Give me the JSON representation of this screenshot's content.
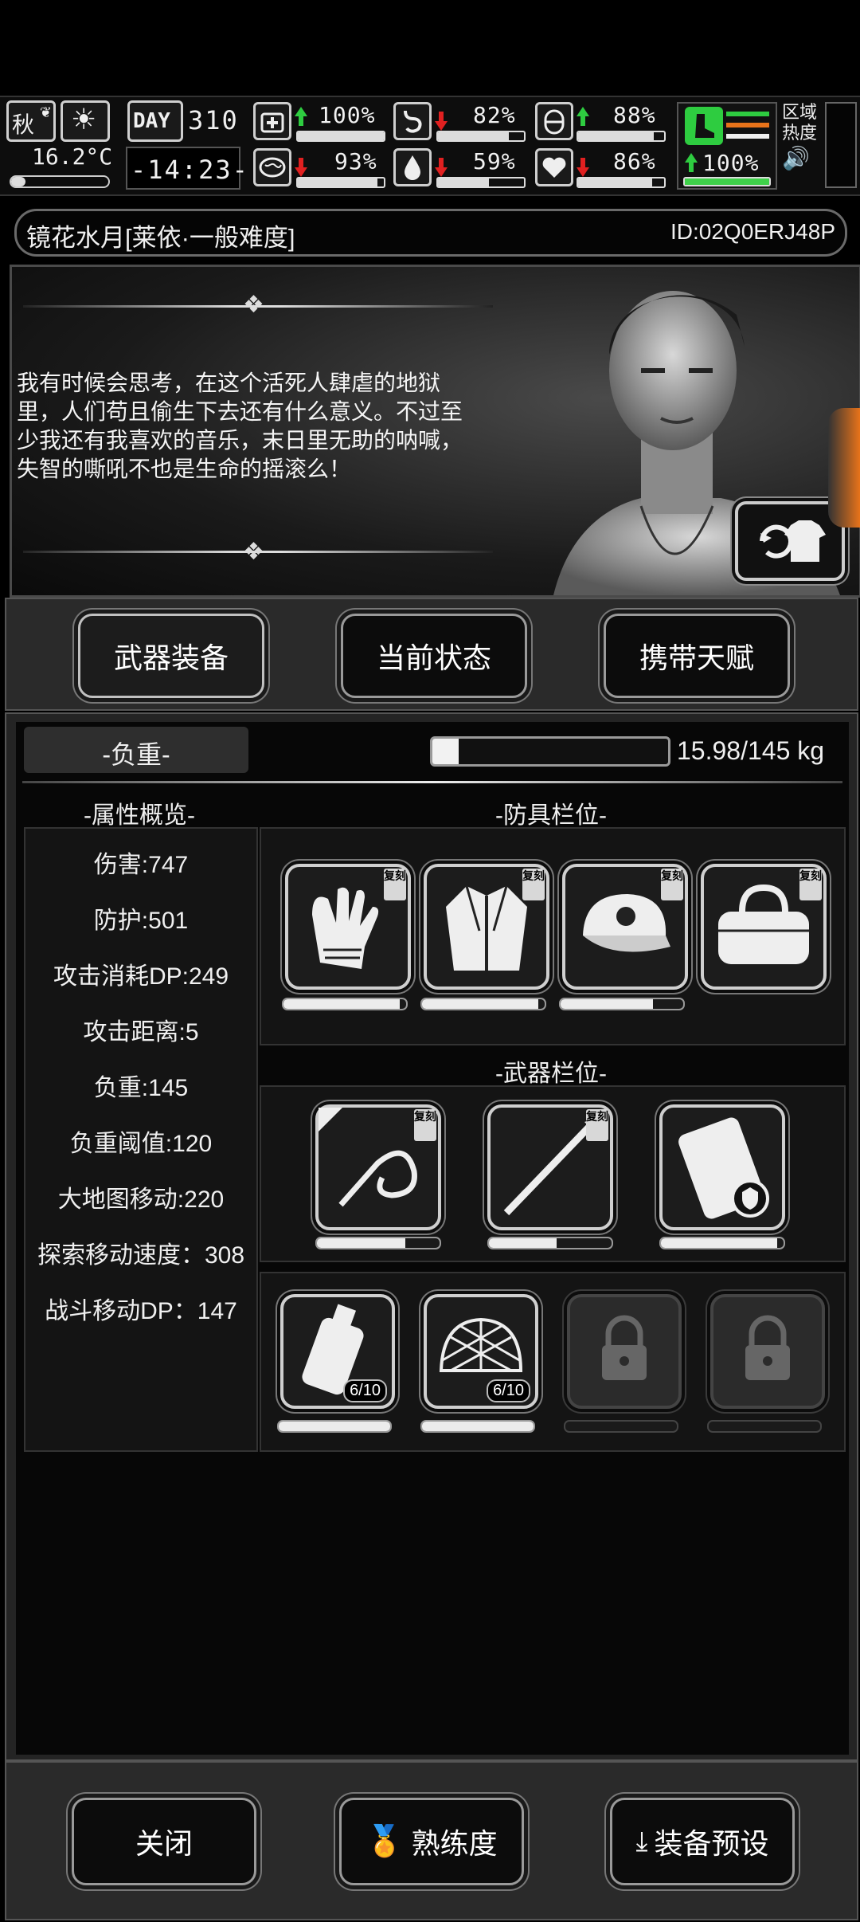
{
  "status": {
    "season": "秋",
    "day_label": "DAY",
    "day_number": "310",
    "temperature": "16.2°C",
    "clock": "-14:23-",
    "stats": [
      {
        "icon": "medkit-icon",
        "value": "100%",
        "trend": "up",
        "level": 1.0
      },
      {
        "icon": "stomach-icon",
        "value": "82%",
        "trend": "down",
        "level": 0.82
      },
      {
        "icon": "capsule-icon",
        "value": "88%",
        "trend": "up",
        "level": 0.88
      },
      {
        "icon": "brain-icon",
        "value": "93%",
        "trend": "down",
        "level": 0.93
      },
      {
        "icon": "water-drop-icon",
        "value": "59%",
        "trend": "down",
        "level": 0.59
      },
      {
        "icon": "heart-icon",
        "value": "86%",
        "trend": "down",
        "level": 0.86
      }
    ],
    "stamina": {
      "value": "100%",
      "trend": "up",
      "level": 1.0
    },
    "zone_heat_label": "区域热度"
  },
  "title": {
    "save_name": "镜花水月[莱依·一般难度]",
    "player_id": "ID:02Q0ERJ48P"
  },
  "portrait": {
    "quote": "我有时候会思考，在这个活死人肆虐的地狱里，人们苟且偷生下去还有什么意义。不过至少我还有我喜欢的音乐，末日里无助的呐喊，失智的嘶吼不也是生命的摇滚么！"
  },
  "tabs": [
    {
      "label": "武器装备",
      "active": true
    },
    {
      "label": "当前状态",
      "active": false
    },
    {
      "label": "携带天赋",
      "active": false
    }
  ],
  "load": {
    "label": "-负重-",
    "value_text": "15.98/145 kg",
    "fraction": 0.11
  },
  "attributes": {
    "title": "-属性概览-",
    "items": [
      "伤害:747",
      "防护:501",
      "攻击消耗DP:249",
      "攻击距离:5",
      "负重:145",
      "负重阈值:120",
      "大地图移动:220",
      "探索移动速度：308",
      "战斗移动DP：147"
    ]
  },
  "armor": {
    "title": "-防具栏位-",
    "tag": "复刻",
    "slots": [
      {
        "icon": "gloves-icon",
        "durability": 0.95
      },
      {
        "icon": "jacket-icon",
        "durability": 0.95
      },
      {
        "icon": "cap-icon",
        "durability": 0.75
      },
      {
        "icon": "duffel-bag-icon",
        "durability": 0.0
      }
    ]
  },
  "weapons": {
    "title": "-武器栏位-",
    "tag": "复刻",
    "slots": [
      {
        "icon": "whip-icon",
        "durability": 0.72
      },
      {
        "icon": "spear-icon",
        "durability": 0.55
      },
      {
        "icon": "shield-pack-icon",
        "durability": 0.95
      }
    ]
  },
  "consumables": [
    {
      "icon": "water-bottle-icon",
      "count": "6/10",
      "durability": 1.0,
      "locked": false
    },
    {
      "icon": "net-icon",
      "count": "6/10",
      "durability": 1.0,
      "locked": false
    },
    {
      "icon": "lock-icon",
      "locked": true
    },
    {
      "icon": "lock-icon",
      "locked": true
    }
  ],
  "footer": {
    "close": "关闭",
    "proficiency": "熟练度",
    "preset": "装备预设"
  }
}
